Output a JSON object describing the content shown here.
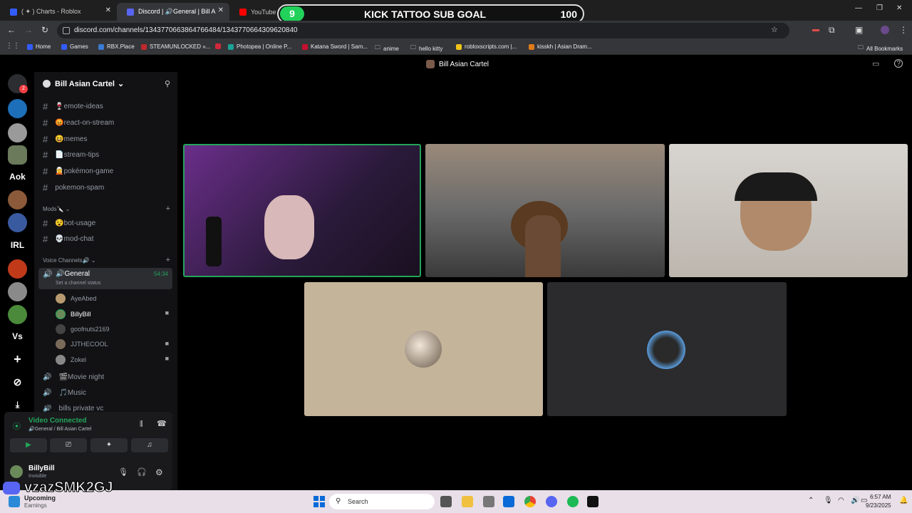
{
  "browser": {
    "tabs": [
      {
        "label": "( ✦ ) Charts - Roblox"
      },
      {
        "label": "Discord | 🔊General | Bill A"
      },
      {
        "label": "YouTube"
      },
      {
        "label": "K"
      }
    ],
    "url": "discord.com/channels/1343770663864766484/1343770664309620840",
    "bookmarks": [
      "Home",
      "Games",
      "RBX.Place",
      "STEAMUNLOCKED »...",
      "Photopea | Online P...",
      "Katana Sword | Sam...",
      "anime",
      "hello kitty",
      "robloxscripts.com |...",
      "kisskh | Asian Dram...",
      "All Bookmarks"
    ]
  },
  "overlay": {
    "count": "9",
    "goal": "KICK TATTOO SUB GOAL",
    "target": "100"
  },
  "discord": {
    "window_title": "Bill Asian Cartel",
    "server_name": "Bill Asian Cartel",
    "rail_badge": "2",
    "rail_text": [
      "Aok",
      "IRL",
      "Vs"
    ],
    "text_channels": [
      "🍷emote-ideas",
      "😡react-on-stream",
      "😆memes",
      "📄stream-tips",
      "🧝pokémon-game",
      "pokemon-spam"
    ],
    "mods_category": "Mods🔪",
    "mod_channels": [
      "😵bot-usage",
      "💀mod-chat"
    ],
    "voice_category": "Voice Channels🔊",
    "active_voice": {
      "name": "🔊General",
      "time": "54:34",
      "status_hint": "Set a channel status"
    },
    "members": [
      "AyeAbed",
      "BillyBill",
      "goofnuts2169",
      "JJTHECOOL",
      "Zokel"
    ],
    "other_voice": [
      "🎬Movie night",
      "🎵Music",
      "bills private vc"
    ],
    "voice_panel": {
      "status": "Video Connected",
      "location": "🔊General / Bill Asian Cartel"
    },
    "user": {
      "name": "BillyBill",
      "status": "Invisible"
    }
  },
  "taskbar": {
    "search": "Search",
    "time": "6:57 AM",
    "date": "9/23/2025",
    "widget_title": "Upcoming",
    "widget_sub": "Earnings",
    "watermark": "vzazSMK2GJ"
  }
}
